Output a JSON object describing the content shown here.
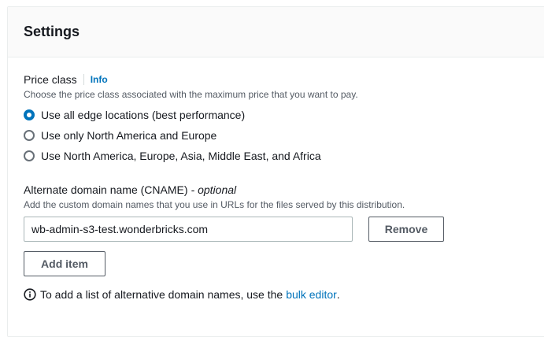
{
  "header": {
    "title": "Settings"
  },
  "price_class": {
    "label": "Price class",
    "info_link": "Info",
    "description": "Choose the price class associated with the maximum price that you want to pay.",
    "options": [
      {
        "label": "Use all edge locations (best performance)",
        "selected": true
      },
      {
        "label": "Use only North America and Europe",
        "selected": false
      },
      {
        "label": "Use North America, Europe, Asia, Middle East, and Africa",
        "selected": false
      }
    ]
  },
  "alternate_domain": {
    "label": "Alternate domain name (CNAME)",
    "optional": "- optional",
    "description": "Add the custom domain names that you use in URLs for the files served by this distribution.",
    "items": [
      {
        "value": "wb-admin-s3-test.wonderbricks.com",
        "remove_label": "Remove"
      }
    ],
    "add_item_label": "Add item",
    "hint_text": "To add a list of alternative domain names, use the",
    "hint_link": "bulk editor",
    "hint_end": "."
  },
  "colors": {
    "accent": "#0073bb",
    "header_bg": "#fafafa",
    "border": "#eaeded",
    "text": "#16191f",
    "muted_text": "#545b64"
  },
  "icons": {
    "hint": "info-circle-icon"
  }
}
